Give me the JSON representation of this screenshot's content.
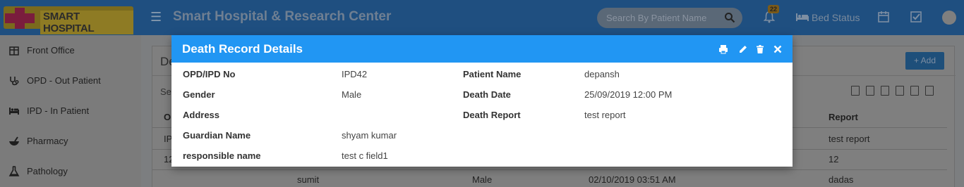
{
  "app": {
    "logo_text": "SMART HOSPITAL",
    "title": "Smart Hospital & Research Center",
    "search_placeholder": "Search By Patient Name",
    "notification_count": "22",
    "bed_status_label": "Bed Status"
  },
  "sidebar": {
    "items": [
      {
        "label": "Front Office",
        "icon": "front-office-icon"
      },
      {
        "label": "OPD - Out Patient",
        "icon": "stethoscope-icon"
      },
      {
        "label": "IPD - In Patient",
        "icon": "bed-icon"
      },
      {
        "label": "Pharmacy",
        "icon": "mortar-pestle-icon"
      },
      {
        "label": "Pathology",
        "icon": "flask-icon"
      }
    ]
  },
  "page": {
    "box_title_partial": "De",
    "add_button": "+ Add",
    "search_partial": "Sea",
    "table": {
      "visible_headers": {
        "first": "O",
        "last": "Report"
      },
      "rows": [
        {
          "first": "IP",
          "report": "test report"
        },
        {
          "first": "12",
          "report": "12"
        },
        {
          "name": "sumit",
          "gender": "Male",
          "death_date": "02/10/2019 03:51 AM",
          "report": "dadas"
        }
      ]
    }
  },
  "modal": {
    "title": "Death Record Details",
    "fields_left": [
      {
        "label": "OPD/IPD No",
        "value": "IPD42"
      },
      {
        "label": "Gender",
        "value": "Male"
      },
      {
        "label": "Address",
        "value": ""
      },
      {
        "label": "Guardian Name",
        "value": "shyam kumar"
      },
      {
        "label": "responsible name",
        "value": "test c field1"
      }
    ],
    "fields_right": [
      {
        "label": "Patient Name",
        "value": "depansh"
      },
      {
        "label": "Death Date",
        "value": "25/09/2019 12:00 PM"
      },
      {
        "label": "Death Report",
        "value": "test report"
      }
    ]
  },
  "colors": {
    "modal_header": "#2196f3",
    "topbar": "#1f4f80"
  }
}
